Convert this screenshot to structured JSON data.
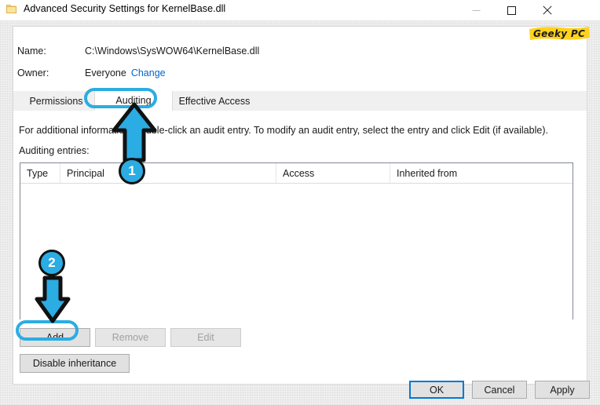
{
  "window": {
    "title": "Advanced Security Settings for KernelBase.dll",
    "icon": "folder-icon",
    "controls": {
      "minimize": "minimize-icon",
      "maximize": "maximize-icon",
      "close": "close-icon"
    }
  },
  "info": {
    "name_label": "Name:",
    "name_value": "C:\\Windows\\SysWOW64\\KernelBase.dll",
    "owner_label": "Owner:",
    "owner_value": "Everyone",
    "owner_change_link": "Change"
  },
  "tabs": [
    {
      "label": "Permissions",
      "selected": false
    },
    {
      "label": "Auditing",
      "selected": true
    },
    {
      "label": "Effective Access",
      "selected": false
    }
  ],
  "main": {
    "instructions": "For additional information, double-click an audit entry. To modify an audit entry, select the entry and click Edit (if available).",
    "entries_label": "Auditing entries:",
    "columns": [
      "Type",
      "Principal",
      "Access",
      "Inherited from"
    ],
    "rows": []
  },
  "buttons": {
    "add": "Add",
    "remove": "Remove",
    "edit": "Edit",
    "disable_inheritance": "Disable inheritance"
  },
  "footer": {
    "ok": "OK",
    "cancel": "Cancel",
    "apply": "Apply"
  },
  "annotations": {
    "badge_1": "1",
    "badge_2": "2",
    "highlight_color": "#2BACE3",
    "arrow_1_target": "Auditing tab",
    "arrow_2_target": "Add button"
  },
  "watermark": {
    "text": "Geeky PC",
    "highlight_color": "#FFD21E"
  }
}
